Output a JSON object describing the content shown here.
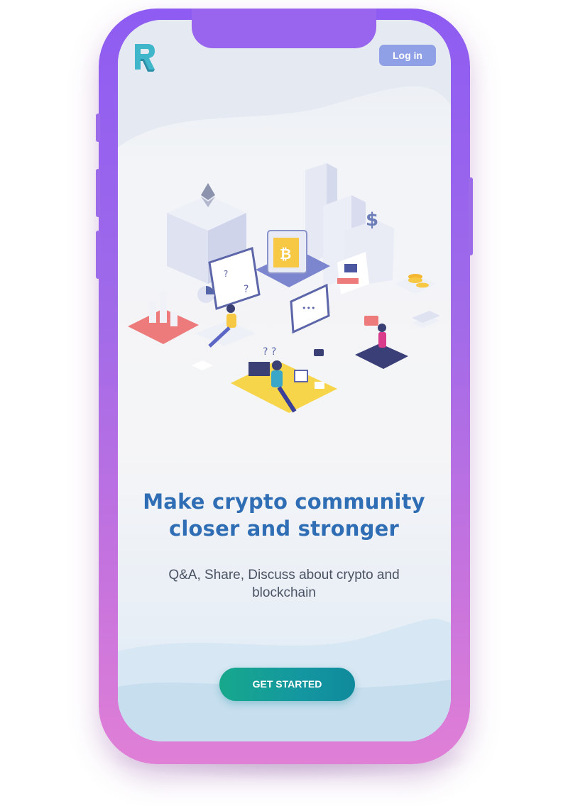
{
  "header": {
    "logo_icon": "r-logo-icon",
    "login_label": "Log in"
  },
  "hero": {
    "illustration_icon": "crypto-community-isometric-illustration",
    "headline_line1": "Make crypto community",
    "headline_line2": "closer and stronger",
    "subtitle_line1": "Q&A, Share, Discuss about crypto and",
    "subtitle_line2": "blockchain"
  },
  "cta": {
    "label": "GET STARTED"
  },
  "colors": {
    "frame_top": "#8e5cf2",
    "frame_bottom": "#e07fd6",
    "headline": "#2f6eb5",
    "login_bg": "#8fa0e6",
    "cta_start": "#17a88c",
    "cta_end": "#0f8a9c"
  }
}
